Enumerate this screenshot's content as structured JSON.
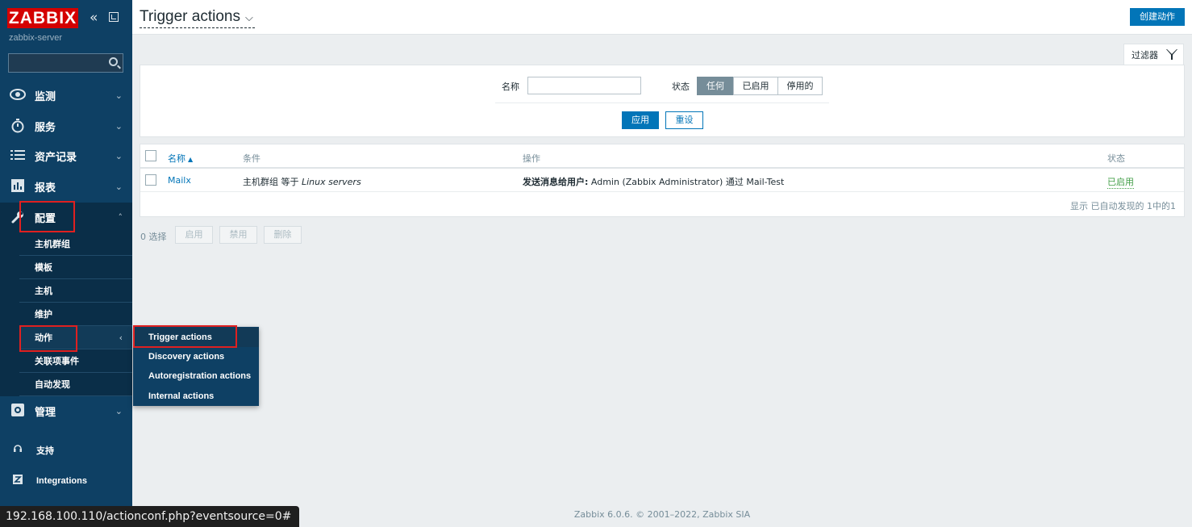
{
  "brand": {
    "logo_text": "ZABBIX",
    "server_name": "zabbix-server",
    "collapse_glyph": "«"
  },
  "search": {
    "value": "",
    "placeholder": ""
  },
  "sidebar": {
    "items": [
      {
        "label": "监测",
        "icon": "eye-icon",
        "arrow": "⌄"
      },
      {
        "label": "服务",
        "icon": "stopwatch-icon",
        "arrow": "⌄"
      },
      {
        "label": "资产记录",
        "icon": "list-icon",
        "arrow": "⌄"
      },
      {
        "label": "报表",
        "icon": "chart-icon",
        "arrow": "⌄"
      },
      {
        "label": "配置",
        "icon": "wrench-icon",
        "arrow": "˄"
      },
      {
        "label": "管理",
        "icon": "gear-icon",
        "arrow": "⌄"
      }
    ],
    "config_sub": [
      "主机群组",
      "模板",
      "主机",
      "维护",
      "动作",
      "关联项事件",
      "自动发现"
    ],
    "sub_arrow": "‹",
    "bottom": [
      {
        "label": "支持",
        "icon": "headset-icon"
      },
      {
        "label": "Integrations",
        "icon": "zabbix-integrations-icon"
      }
    ]
  },
  "flyout": [
    "Trigger actions",
    "Discovery actions",
    "Autoregistration actions",
    "Internal actions"
  ],
  "header": {
    "title": "Trigger actions",
    "title_chevron": "⌵",
    "create_button": "创建动作"
  },
  "filter": {
    "tab_label": "过滤器",
    "name_label": "名称",
    "name_value": "",
    "status_label": "状态",
    "status_options": [
      "任何",
      "已启用",
      "停用的"
    ],
    "status_selected": "任何",
    "apply": "应用",
    "reset": "重设"
  },
  "table": {
    "headers": {
      "name": "名称",
      "sort": "▲",
      "conditions": "条件",
      "operations": "操作",
      "status": "状态"
    },
    "rows": [
      {
        "name": "Mailx",
        "condition_prefix": "主机群组 等于 ",
        "condition_value": "Linux servers",
        "operation_prefix": "发送消息给用户:",
        "operation_detail": " Admin (Zabbix Administrator) 通过 Mail-Test",
        "status": "已启用"
      }
    ],
    "footer": "显示 已自动发现的 1中的1"
  },
  "mass_actions": {
    "selected": "0 选择",
    "enable": "启用",
    "disable": "禁用",
    "delete": "删除"
  },
  "footer": {
    "text": "Zabbix 6.0.6. © 2001–2022, Zabbix SIA"
  },
  "browser_status": {
    "url": "192.168.100.110/actionconf.php?eventsource=0#"
  },
  "colors": {
    "sidebar": "#0e4064",
    "accent": "#0275b8",
    "enabled": "#429e47",
    "highlight_box": "#e02020",
    "logo": "#d40000"
  }
}
